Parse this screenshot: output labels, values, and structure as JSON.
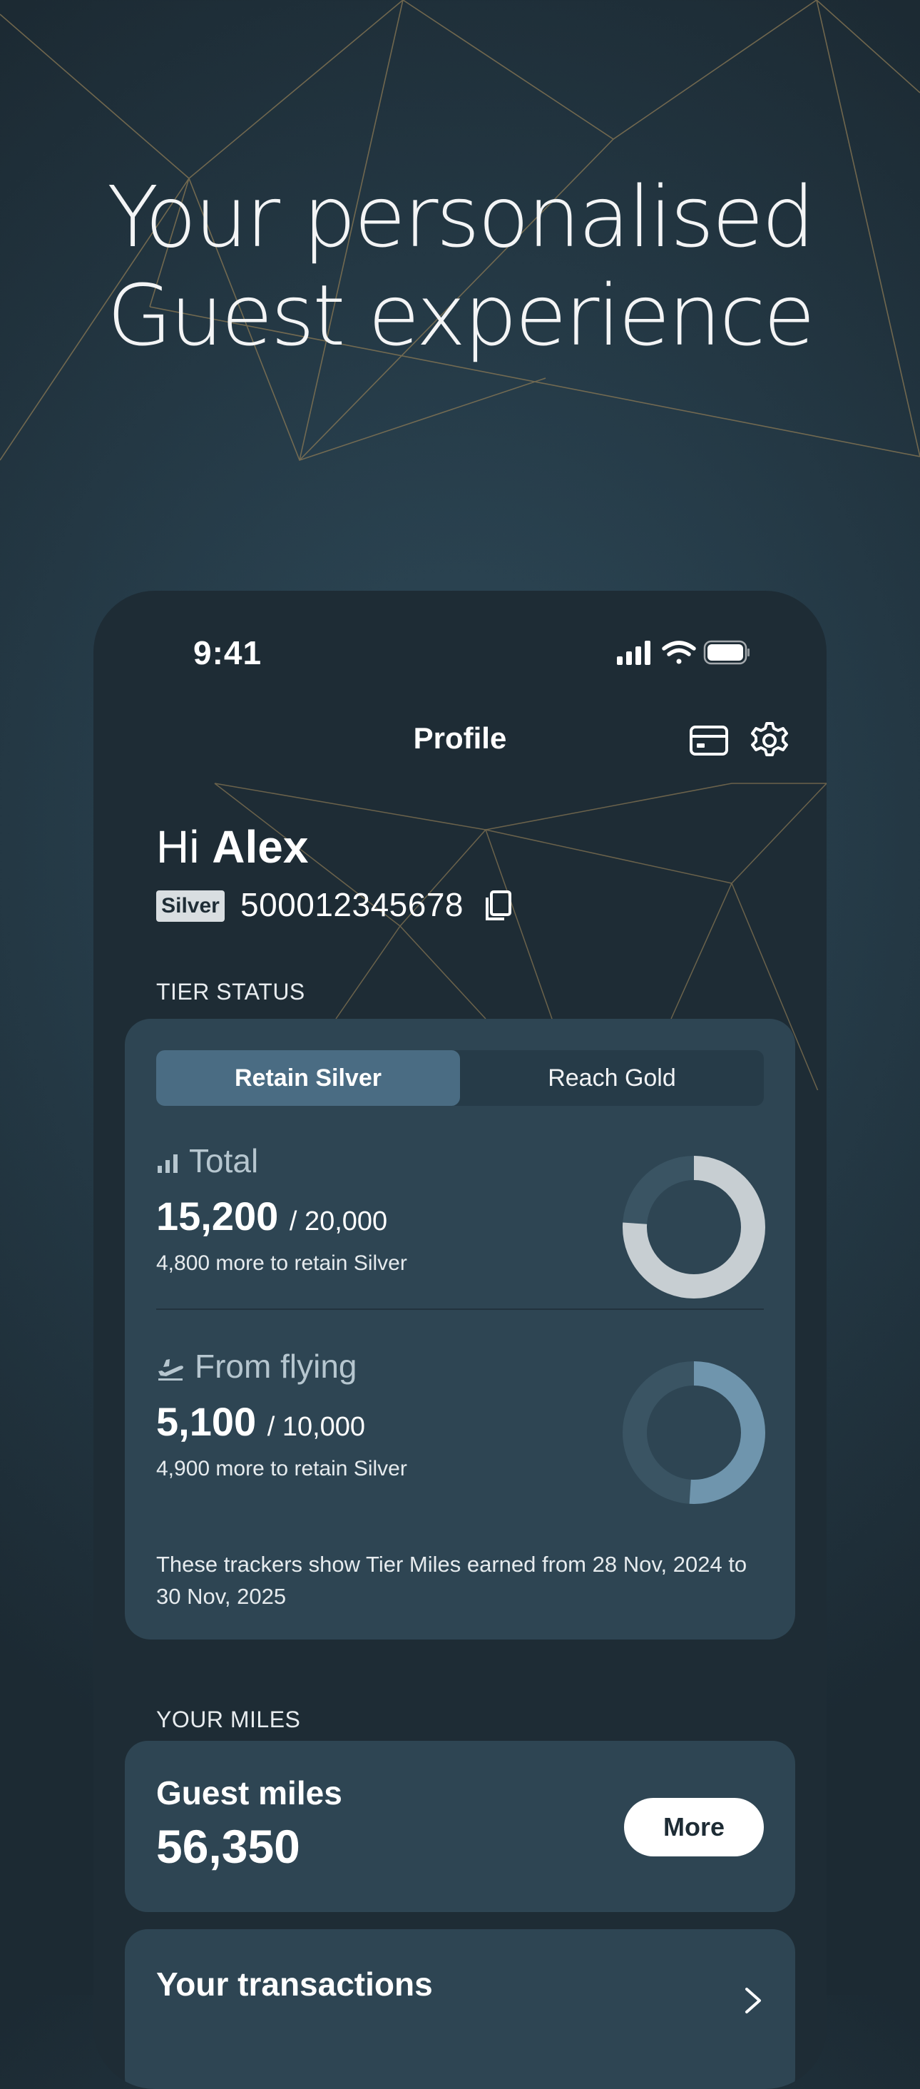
{
  "hero": {
    "line1": "Your personalised",
    "line2": "Guest experience"
  },
  "status_bar": {
    "time": "9:41",
    "icons": [
      "signal-icon",
      "wifi-icon",
      "battery-icon"
    ]
  },
  "nav": {
    "title": "Profile",
    "icons": [
      "card-icon",
      "gear-icon"
    ]
  },
  "greeting": {
    "hi": "Hi",
    "name": "Alex"
  },
  "member": {
    "tier": "Silver",
    "number": "500012345678"
  },
  "tier_status": {
    "section_label": "TIER STATUS",
    "tabs": [
      {
        "label": "Retain Silver",
        "active": true
      },
      {
        "label": "Reach Gold",
        "active": false
      }
    ],
    "metrics": [
      {
        "icon": "bar-chart-icon",
        "title": "Total",
        "value": "15,200",
        "target": "/ 20,000",
        "sub": "4,800 more to retain Silver",
        "progress": 0.76
      },
      {
        "icon": "plane-takeoff-icon",
        "title": "From flying",
        "value": "5,100",
        "target": "/ 10,000",
        "sub": "4,900 more to retain Silver",
        "progress": 0.51
      }
    ],
    "footnote": "These trackers show Tier Miles earned from 28 Nov, 2024 to 30 Nov, 2025"
  },
  "your_miles": {
    "section_label": "YOUR MILES",
    "label": "Guest miles",
    "value": "56,350",
    "button": "More"
  },
  "transactions": {
    "label": "Your transactions"
  },
  "colors": {
    "background": "#263c49",
    "phone": "#1e2c35",
    "card": "#2e4553",
    "accent": "#4a6c83",
    "gold_line": "#8c7a55"
  }
}
